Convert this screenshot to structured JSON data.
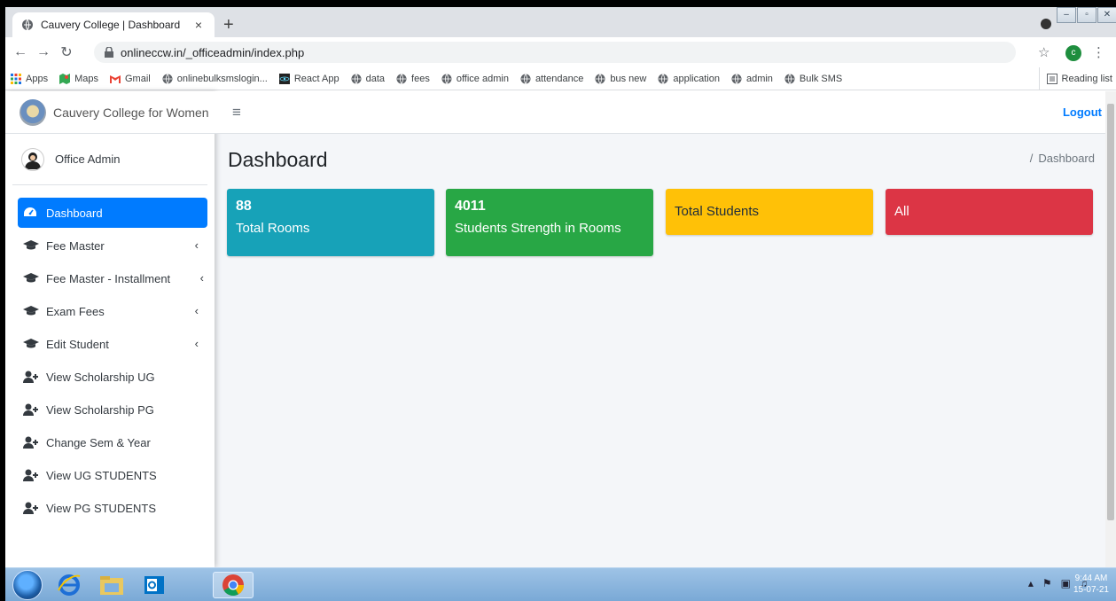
{
  "browser": {
    "tab_title": "Cauvery College | Dashboard",
    "tab_close": "×",
    "new_tab": "+",
    "url": "onlineccw.in/_officeadmin/index.php",
    "profile_letter": "c",
    "bookmarks": [
      {
        "label": "Apps",
        "icon": "apps-grid-icon"
      },
      {
        "label": "Maps",
        "icon": "maps-icon"
      },
      {
        "label": "Gmail",
        "icon": "gmail-icon"
      },
      {
        "label": "onlinebulksmslogin...",
        "icon": "globe-icon"
      },
      {
        "label": "React App",
        "icon": "react-icon"
      },
      {
        "label": "data",
        "icon": "globe-icon"
      },
      {
        "label": "fees",
        "icon": "globe-icon"
      },
      {
        "label": "office admin",
        "icon": "globe-icon"
      },
      {
        "label": "attendance",
        "icon": "globe-icon"
      },
      {
        "label": "bus new",
        "icon": "globe-icon"
      },
      {
        "label": "application",
        "icon": "globe-icon"
      },
      {
        "label": "admin",
        "icon": "globe-icon"
      },
      {
        "label": "Bulk SMS",
        "icon": "globe-icon"
      }
    ],
    "reading_list": "Reading list"
  },
  "sidebar": {
    "brand": "Cauvery College for Women",
    "user": "Office Admin",
    "items": [
      {
        "label": "Dashboard",
        "icon": "dashboard-icon",
        "active": true
      },
      {
        "label": "Fee Master",
        "icon": "graduation-cap-icon",
        "caret": "‹"
      },
      {
        "label": "Fee Master - Installment",
        "icon": "graduation-cap-icon",
        "caret": "‹"
      },
      {
        "label": "Exam Fees",
        "icon": "graduation-cap-icon",
        "caret": "‹"
      },
      {
        "label": "Edit Student",
        "icon": "graduation-cap-icon",
        "caret": "‹"
      },
      {
        "label": "View Scholarship UG",
        "icon": "user-plus-icon"
      },
      {
        "label": "View Scholarship PG",
        "icon": "user-plus-icon"
      },
      {
        "label": "Change Sem & Year",
        "icon": "user-plus-icon"
      },
      {
        "label": "View UG STUDENTS",
        "icon": "user-plus-icon"
      },
      {
        "label": "View PG STUDENTS",
        "icon": "user-plus-icon"
      }
    ]
  },
  "header": {
    "menu_toggle": "≡",
    "logout": "Logout"
  },
  "main": {
    "title": "Dashboard",
    "breadcrumb_sep": "/",
    "breadcrumb": "Dashboard",
    "boxes": [
      {
        "number": "88",
        "label": "Total Rooms",
        "color": "#17a2b8"
      },
      {
        "number": "4011",
        "label": "Students Strength in Rooms",
        "color": "#28a745"
      },
      {
        "number": "",
        "label": "Total Students",
        "color": "#ffc107"
      },
      {
        "number": "",
        "label": "All",
        "color": "#dc3545"
      }
    ]
  },
  "taskbar": {
    "time": "9:44 AM",
    "date": "15-07-21"
  },
  "colors": {
    "primary": "#007bff",
    "info": "#17a2b8",
    "success": "#28a745",
    "warning": "#ffc107",
    "danger": "#dc3545"
  }
}
